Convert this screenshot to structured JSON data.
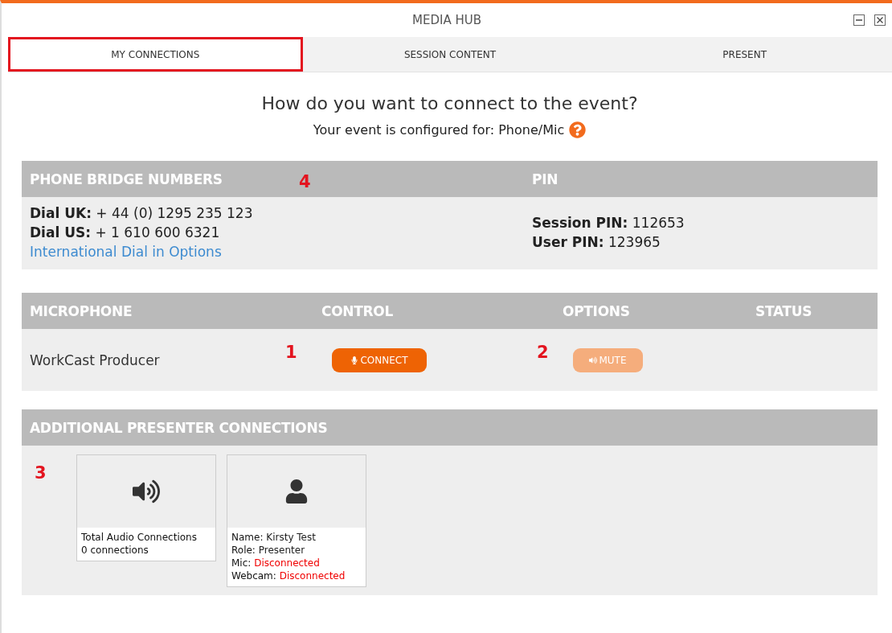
{
  "window": {
    "title": "MEDIA HUB"
  },
  "tabs": [
    {
      "label": "MY CONNECTIONS",
      "selected": true,
      "highlighted": true
    },
    {
      "label": "SESSION CONTENT",
      "selected": false,
      "highlighted": false
    },
    {
      "label": "PRESENT",
      "selected": false,
      "highlighted": false
    }
  ],
  "heading": "How do you want to connect to the event?",
  "configured": {
    "text": "Your event is configured for: Phone/Mic"
  },
  "bridge": {
    "marker": "4",
    "columns": [
      "PHONE BRIDGE NUMBERS",
      "PIN"
    ],
    "numbers": [
      "**Dial UK:** + 44 (0) 1295 235 123",
      "**Dial US:** + 1 610 600 6321"
    ],
    "link": "International Dial in Options",
    "pins": [
      "**Session PIN:** 112653",
      "**User PIN:** 123965"
    ]
  },
  "microphone": {
    "columns": [
      "MICROPHONE",
      "CONTROL",
      "OPTIONS",
      "STATUS"
    ],
    "rows": [
      {
        "name": "WorkCast Producer",
        "control_marker": "1",
        "control": {
          "label": "CONNECT",
          "disabled": false
        },
        "options_marker": "2",
        "option": {
          "label": "MUTE",
          "disabled": true
        }
      }
    ]
  },
  "additional": {
    "title": "ADDITIONAL PRESENTER CONNECTIONS",
    "marker": "3",
    "cards": [
      {
        "kind": "audio",
        "lines": [
          {
            "label": "Total Audio Connections"
          },
          {
            "label": "0 connections"
          }
        ]
      },
      {
        "kind": "person",
        "lines": [
          {
            "label": "Name:",
            "value": "Kirsty Test",
            "alert": false
          },
          {
            "label": "Role:",
            "value": "Presenter",
            "alert": false
          },
          {
            "label": "Mic:",
            "value": "Disconnected",
            "alert": true
          },
          {
            "label": "Webcam:",
            "value": "Disconnected",
            "alert": true
          }
        ]
      }
    ]
  }
}
